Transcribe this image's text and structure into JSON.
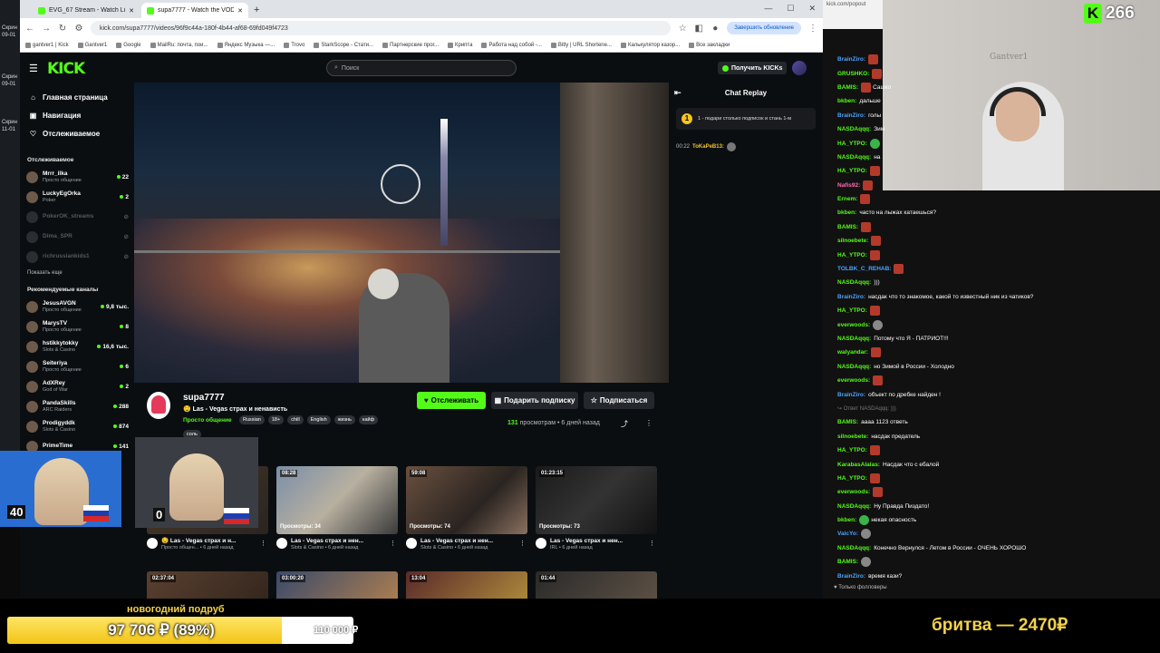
{
  "desktop": {
    "labels": [
      "Скрин",
      "09-01",
      "Скрин",
      "09-01",
      "Скрин",
      "11-01"
    ]
  },
  "browser": {
    "tabs": [
      {
        "label": "EVG_67 Stream - Watch Live on Kick"
      },
      {
        "label": "supa7777 - Watch the VOD on Kick"
      }
    ],
    "url": "kick.com/supa7777/videos/96f9c44a-180f-4b44-af68-69fd049f4723",
    "update_label": "Завершить обновление",
    "bookmarks": [
      "gantver1 | Kick",
      "Gantver1",
      "Google",
      "MailRu: почта, пои...",
      "Яндекс Музыка —...",
      "Trovo",
      "StarkScope - Стати...",
      "Партнерские прог...",
      "Крипта",
      "Работа над собой -...",
      "Bitly | URL Shortene...",
      "Калькулятор казор...",
      "Все закладки"
    ]
  },
  "kick": {
    "logo": "KICK",
    "search_placeholder": "Поиск",
    "get_kicks_label": "Получить KICKs",
    "nav": [
      {
        "label": "Главная страница",
        "icon": "home-icon"
      },
      {
        "label": "Навигация",
        "icon": "compass-icon"
      },
      {
        "label": "Отслеживаемое",
        "icon": "heart-icon"
      }
    ],
    "following_heading": "Отслеживаемое",
    "following": [
      {
        "name": "Mrrr_ilka",
        "category": "Просто общение",
        "viewers": "22",
        "online": true
      },
      {
        "name": "LuckyEgOrka",
        "category": "Poker",
        "viewers": "2",
        "online": true
      },
      {
        "name": "PokerOK_streams",
        "category": "",
        "viewers": "",
        "online": false
      },
      {
        "name": "Dima_SPR",
        "category": "",
        "viewers": "",
        "online": false
      },
      {
        "name": "richrussiankids1",
        "category": "",
        "viewers": "",
        "online": false
      }
    ],
    "show_more": "Показать еще",
    "recommended_heading": "Рекомендуемые каналы",
    "recommended": [
      {
        "name": "JesusAVGN",
        "category": "Просто общение",
        "viewers": "9,8 тыс."
      },
      {
        "name": "MarysTV",
        "category": "Просто общение",
        "viewers": "8"
      },
      {
        "name": "hstikkytokky",
        "category": "Slots & Casino",
        "viewers": "16,6 тыс."
      },
      {
        "name": "Seiteriya",
        "category": "Просто общение",
        "viewers": "6"
      },
      {
        "name": "AdXRey",
        "category": "God of War",
        "viewers": "2"
      },
      {
        "name": "PandaSkills",
        "category": "ARC Raiders",
        "viewers": "288"
      },
      {
        "name": "Prodigyddk",
        "category": "Slots & Casino",
        "viewers": "874"
      },
      {
        "name": "PrimeTime",
        "category": "",
        "viewers": "141"
      }
    ],
    "channel": {
      "name": "supa7777",
      "title": "🤤 Las - Vegas  страх и  ненависть",
      "category": "Просто общение",
      "tags": [
        "Russian",
        "18+",
        "chill",
        "English",
        "жизнь",
        "кайф"
      ],
      "extra_tag": "соль",
      "follow_label": "Отслеживать",
      "gift_label": "Подарить подписку",
      "subscribe_label": "Подписаться",
      "views_count": "131",
      "views_text": "просмотрам",
      "date_text": "• 6 дней назад"
    },
    "chat_replay": {
      "title": "Chat Replay",
      "pinned_badge": "1",
      "pinned_text": "1 - подари столько подписок и стань 1-м",
      "message_time": "00:22",
      "message_user": "ToKaPeB13:"
    },
    "vods": [
      {
        "duration": "",
        "views": "",
        "title": "🤤 Las - Vegas страх и н...",
        "sub": "Просто общен... • 6 дней назад"
      },
      {
        "duration": "08:28",
        "views": "Просмотры: 34",
        "title": "Las - Vegas страх и нен...",
        "sub": "Slots & Casino • 6 дней назад"
      },
      {
        "duration": "59:08",
        "views": "Просмотры: 74",
        "title": "Las - Vegas страх и нен...",
        "sub": "Slots & Casino • 6 дней назад"
      },
      {
        "duration": "01:23:15",
        "views": "Просмотры: 73",
        "title": "Las - Vegas страх и нен...",
        "sub": "IRL • 6 дней назад"
      },
      {
        "duration": "02:37:04",
        "views": "",
        "title": "",
        "sub": ""
      },
      {
        "duration": "03:00:20",
        "views": "",
        "title": "",
        "sub": ""
      },
      {
        "duration": "13:04",
        "views": "",
        "title": "",
        "sub": ""
      },
      {
        "duration": "01:44",
        "views": "",
        "title": "",
        "sub": ""
      }
    ]
  },
  "overlay": {
    "viewer_count": "266",
    "cam_text": "Gantver1",
    "pip_counts": [
      "40",
      "0"
    ],
    "chat_site": "kick.com/popout",
    "chat": [
      {
        "user": "BrainZiro:",
        "color": "#4aa3ff",
        "text": "",
        "emote": "red"
      },
      {
        "user": "GRUSHKO:",
        "color": "#53fc18",
        "text": "",
        "emote": "red"
      },
      {
        "user": "BAMIS:",
        "color": "#53fc18",
        "text": "Сашко",
        "emote": "red"
      },
      {
        "user": "bkben:",
        "color": "#53fc18",
        "text": "дальше",
        "emote": ""
      },
      {
        "user": "BrainZiro:",
        "color": "#4aa3ff",
        "text": "голы",
        "emote": ""
      },
      {
        "user": "NASDAqqq:",
        "color": "#53fc18",
        "text": "Зим",
        "emote": ""
      },
      {
        "user": "HA_YTPO:",
        "color": "#53fc18",
        "text": "",
        "emote": "green"
      },
      {
        "user": "NASDAqqq:",
        "color": "#53fc18",
        "text": "на",
        "emote": ""
      },
      {
        "user": "HA_YTPO:",
        "color": "#53fc18",
        "text": "",
        "emote": "red"
      },
      {
        "user": "Nafis92:",
        "color": "#ff6ab0",
        "text": "",
        "emote": "red"
      },
      {
        "user": "Ernem:",
        "color": "#53fc18",
        "text": "",
        "emote": "red"
      },
      {
        "user": "bkben:",
        "color": "#53fc18",
        "text": "часто на лыжах катаешься?",
        "emote": ""
      },
      {
        "user": "BAMIS:",
        "color": "#53fc18",
        "text": "",
        "emote": "red"
      },
      {
        "user": "silnoebete:",
        "color": "#53fc18",
        "text": "",
        "emote": "red"
      },
      {
        "user": "HA_YTPO:",
        "color": "#53fc18",
        "text": "",
        "emote": "red"
      },
      {
        "user": "TOLBK_C_REHAB:",
        "color": "#4aa3ff",
        "text": "",
        "emote": "red"
      },
      {
        "user": "NASDAqqq:",
        "color": "#53fc18",
        "text": ")))",
        "emote": ""
      },
      {
        "user": "BrainZiro:",
        "color": "#4aa3ff",
        "text": "насдак что то знакомое, какой то известный ник из чатиков?",
        "emote": ""
      },
      {
        "user": "HA_YTPO:",
        "color": "#53fc18",
        "text": "",
        "emote": "red"
      },
      {
        "user": "everwoods:",
        "color": "#53fc18",
        "text": "",
        "emote": "grey"
      },
      {
        "user": "NASDAqqq:",
        "color": "#53fc18",
        "text": "Потому что Я - ПАТРИОТ!!!",
        "emote": ""
      },
      {
        "user": "walyandar:",
        "color": "#53fc18",
        "text": "",
        "emote": "red"
      },
      {
        "user": "NASDAqqq:",
        "color": "#53fc18",
        "text": "но Зимой в России - Холодно",
        "emote": ""
      },
      {
        "user": "everwoods:",
        "color": "#53fc18",
        "text": "",
        "emote": "red"
      },
      {
        "user": "BrainZiro:",
        "color": "#4aa3ff",
        "text": "объект по дребке найден !",
        "emote": ""
      },
      {
        "user": "",
        "color": "#777",
        "text": "↪ Ответ NASDAqqq: )))",
        "emote": "",
        "reply": true
      },
      {
        "user": "BAMIS:",
        "color": "#53fc18",
        "text": "аааа 1123 ответь",
        "emote": ""
      },
      {
        "user": "silnoebete:",
        "color": "#53fc18",
        "text": "насдак предатель",
        "emote": ""
      },
      {
        "user": "HA_YTPO:",
        "color": "#53fc18",
        "text": "",
        "emote": "red"
      },
      {
        "user": "KarabasAlalas:",
        "color": "#53fc18",
        "text": "Насдак что с ебалой",
        "emote": ""
      },
      {
        "user": "HA_YTPO:",
        "color": "#53fc18",
        "text": "",
        "emote": "red"
      },
      {
        "user": "everwoods:",
        "color": "#53fc18",
        "text": "",
        "emote": "red"
      },
      {
        "user": "NASDAqqq:",
        "color": "#53fc18",
        "text": "Ну Правда Пиздато!",
        "emote": ""
      },
      {
        "user": "bkben:",
        "color": "#53fc18",
        "text": "некая опасность",
        "emote": "green"
      },
      {
        "user": "VaicYo:",
        "color": "#4aa3ff",
        "text": "",
        "emote": "grey"
      },
      {
        "user": "NASDAqqq:",
        "color": "#53fc18",
        "text": "Конечно Вернулся - Летом в России - ОЧЕНЬ ХОРОШО",
        "emote": ""
      },
      {
        "user": "BAMIS:",
        "color": "#53fc18",
        "text": "",
        "emote": "grey"
      },
      {
        "user": "BrainZiro:",
        "color": "#4aa3ff",
        "text": "время кази?",
        "emote": ""
      }
    ],
    "followers_only": "♥ Только фолловеры",
    "goal_title": "новогодний подруб",
    "goal_progress": 0.89,
    "goal_text": "97 706 ₽ (89%)",
    "goal_target": "110 000 ₽",
    "promo": "бритва — 2470₽"
  }
}
